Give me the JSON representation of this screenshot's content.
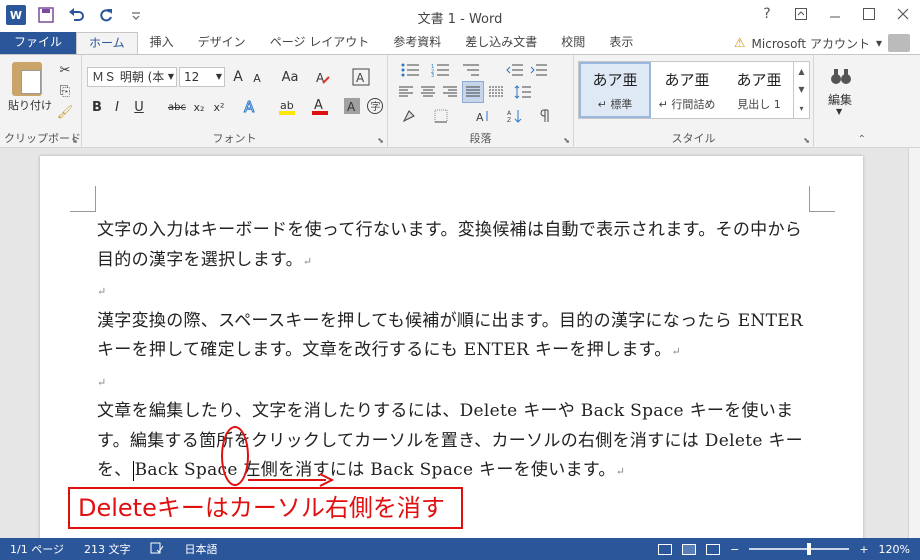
{
  "window": {
    "title": "文書 1 - Word",
    "help": "?",
    "controls": [
      "restore-ribbon",
      "minimize",
      "maximize",
      "close"
    ]
  },
  "qat": {
    "app_icon": "W",
    "icons": [
      "save-icon",
      "undo-icon",
      "redo-icon",
      "customize-icon"
    ]
  },
  "tabs": [
    "ファイル",
    "ホーム",
    "挿入",
    "デザイン",
    "ページ レイアウト",
    "参考資料",
    "差し込み文書",
    "校閲",
    "表示"
  ],
  "account": "Microsoft アカウント",
  "ribbon": {
    "clipboard": {
      "paste_label": "貼り付け",
      "group_label": "クリップボード"
    },
    "font": {
      "font_name": "ＭＳ 明朝 (本",
      "font_size": "12",
      "grow": "A",
      "shrink": "A",
      "case": "Aa",
      "bold": "B",
      "italic": "I",
      "underline": "U",
      "strike": "abc",
      "subscript": "x₂",
      "superscript": "x²",
      "group_label": "フォント"
    },
    "paragraph": {
      "group_label": "段落"
    },
    "styles": {
      "items": [
        {
          "sample": "あア亜",
          "name": "↵ 標準"
        },
        {
          "sample": "あア亜",
          "name": "↵ 行間詰め"
        },
        {
          "sample": "あア亜",
          "name": "見出し 1"
        }
      ],
      "group_label": "スタイル"
    },
    "editing": {
      "label": "編集"
    }
  },
  "document": {
    "paragraphs": [
      "文字の入力はキーボードを使って行ないます。変換候補は自動で表示されます。その中から目的の漢字を選択します。",
      "",
      "漢字変換の際、スペースキーを押しても候補が順に出ます。目的の漢字になったら ENTER キーを押して確定します。文章を改行するにも ENTER キーを押します。",
      "",
      "文章を編集したり、文字を消したりするには、Delete キーや Back Space キーを使います。編集する箇所をクリックしてカーソルを置き、カーソルの右側を消すには Delete キーを、"
    ],
    "last_para_tail": "Back Space 左側を消すには Back Space キーを使います。",
    "para_mark": "↵"
  },
  "annotation": {
    "label": "Deleteキーはカーソル右側を消す",
    "color": "#e01010"
  },
  "status": {
    "page": "1/1 ページ",
    "words": "213 文字",
    "language": "日本語",
    "zoom": "120%",
    "zoom_minus": "−",
    "zoom_plus": "+",
    "zoom_level_fraction": 0.6
  },
  "colors": {
    "accent": "#2b579a",
    "annotation": "#e01010"
  }
}
